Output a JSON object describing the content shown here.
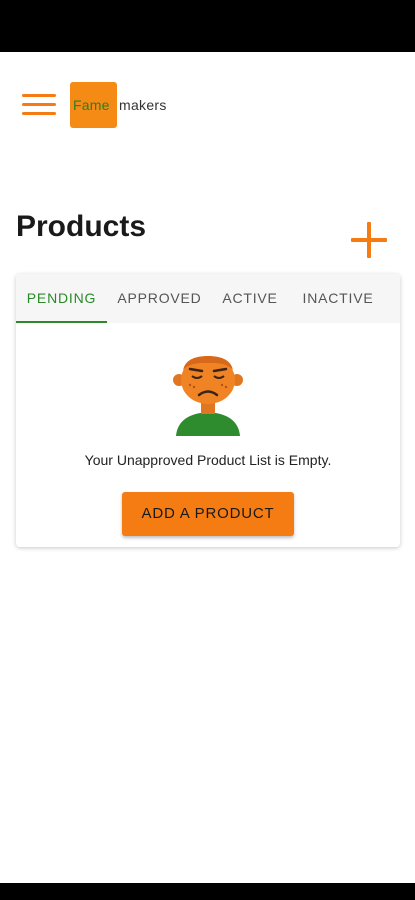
{
  "header": {
    "menu_icon": "hamburger-menu-icon",
    "logo_part1": "Fame",
    "logo_part2": "makers",
    "brand_color": "#f57c13"
  },
  "page": {
    "title": "Products",
    "add_icon": "plus-icon"
  },
  "tabs": [
    {
      "label": "PENDING",
      "active": true
    },
    {
      "label": "APPROVED",
      "active": false
    },
    {
      "label": "ACTIVE",
      "active": false
    },
    {
      "label": "INACTIVE",
      "active": false
    }
  ],
  "empty_state": {
    "illustration": "sad-face-illustration",
    "message": "Your Unapproved Product List is Empty.",
    "button_label": "ADD A PRODUCT"
  },
  "colors": {
    "accent": "#f57c13",
    "active_tab": "#2a8a2a"
  }
}
